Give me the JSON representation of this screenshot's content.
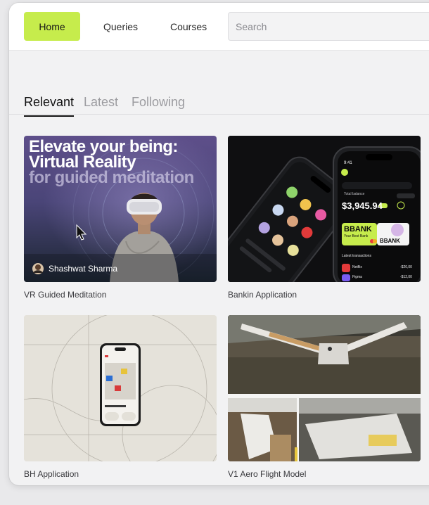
{
  "nav": {
    "home": "Home",
    "queries": "Queries",
    "courses": "Courses",
    "search_placeholder": "Search"
  },
  "tabs": [
    {
      "label": "Relevant",
      "active": true
    },
    {
      "label": "Latest",
      "active": false
    },
    {
      "label": "Following",
      "active": false
    }
  ],
  "cards": [
    {
      "title": "VR Guided Meditation",
      "banner_line1": "Elevate your being:",
      "banner_line2": "Virtual Reality",
      "banner_line3": "for guided meditation",
      "author": "Shashwat Sharma"
    },
    {
      "title": "Bankin Application",
      "phone_time": "9:41",
      "balance_label": "Total balance",
      "balance_value": "$3,945.94",
      "bank_name": "BBANK",
      "bank_sub": "Your Best Bank",
      "transactions_label": "Latest transactions",
      "tx": [
        {
          "name": "Netflix",
          "amount": "-$20,00"
        },
        {
          "name": "Figma",
          "amount": "-$12,00"
        }
      ]
    },
    {
      "title": "BH Application"
    },
    {
      "title": "V1 Aero Flight Model"
    }
  ],
  "colors": {
    "accent": "#c6ec4c",
    "vr_gradient_top": "#5b4d86",
    "vr_gradient_bottom": "#1d2734"
  }
}
